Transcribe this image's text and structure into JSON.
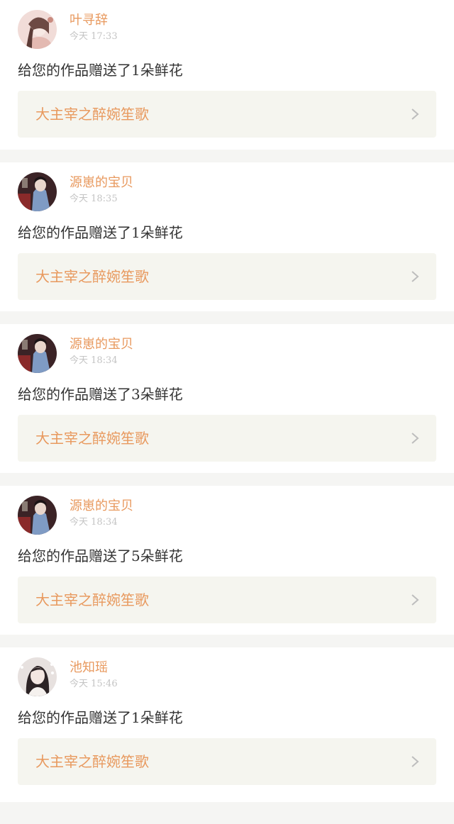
{
  "notifications": [
    {
      "user": "叶寻辞",
      "time": "今天 17:33",
      "message": "给您的作品赠送了1朵鲜花",
      "work_title": "大主宰之醉婉笙歌",
      "avatar": "avatar-girl-pink",
      "colors": {
        "bg": "#f1dcd8",
        "accent": "#c98b80"
      }
    },
    {
      "user": "源崽的宝贝",
      "time": "今天 18:35",
      "message": "给您的作品赠送了1朵鲜花",
      "work_title": "大主宰之醉婉笙歌",
      "avatar": "avatar-stage-performer",
      "colors": {
        "bg": "#3b2326",
        "accent": "#7f9bc4"
      }
    },
    {
      "user": "源崽的宝贝",
      "time": "今天 18:34",
      "message": "给您的作品赠送了3朵鲜花",
      "work_title": "大主宰之醉婉笙歌",
      "avatar": "avatar-stage-performer",
      "colors": {
        "bg": "#3b2326",
        "accent": "#7f9bc4"
      }
    },
    {
      "user": "源崽的宝贝",
      "time": "今天 18:34",
      "message": "给您的作品赠送了5朵鲜花",
      "work_title": "大主宰之醉婉笙歌",
      "avatar": "avatar-stage-performer",
      "colors": {
        "bg": "#3b2326",
        "accent": "#7f9bc4"
      }
    },
    {
      "user": "池知瑶",
      "time": "今天 15:46",
      "message": "给您的作品赠送了1朵鲜花",
      "work_title": "大主宰之醉婉笙歌",
      "avatar": "avatar-girl-dark-hair",
      "colors": {
        "bg": "#e7e1df",
        "accent": "#2c2325"
      }
    }
  ],
  "theme": {
    "accent_orange": "#e8995e",
    "time_gray": "#c4c4c4",
    "text_dark": "#333333",
    "link_bg": "#f5f5ef",
    "page_bg": "#f5f5f3"
  },
  "icons": {
    "link_arrow": "chevron-right-icon"
  }
}
